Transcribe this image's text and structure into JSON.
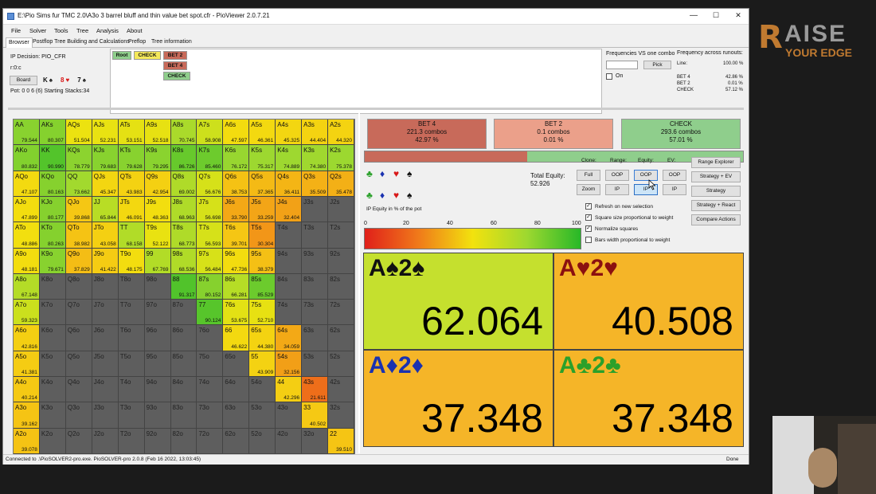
{
  "window": {
    "title": "E:\\Pio Sims fur TMC 2.0\\A3o 3 barrel bluff and thin value bet spot.cfr - PioViewer 2.0.7.21",
    "minimize": "—",
    "maximize": "☐",
    "close": "✕"
  },
  "menu": [
    "File",
    "Solver",
    "Tools",
    "Tree",
    "Analysis",
    "About"
  ],
  "tabs": [
    "Browser",
    "Postflop Tree Building and Calculations",
    "Preflop",
    "Tree information"
  ],
  "info": {
    "ip_decision": "IP Decision:  PIO_CFR",
    "line": "r:0:c",
    "board_button": "Board",
    "board_cards": [
      {
        "rank": "K",
        "suit": "♠",
        "color": "#111111"
      },
      {
        "rank": "8",
        "suit": "♥",
        "color": "#d81818"
      },
      {
        "rank": "7",
        "suit": "♠",
        "color": "#111111"
      }
    ],
    "pot": "Pot: 0 0 6 (6) Starting Stacks:34"
  },
  "tree": {
    "root": "Root",
    "check1": "CHECK",
    "bet2": "BET 2",
    "bet4": "BET 4",
    "check2": "CHECK"
  },
  "freq_panel": {
    "vs_one_combo": "Frequencies VS one combo",
    "pick": "Pick",
    "on": "On",
    "across_runouts": "Frequency across runouts:",
    "line_label": "Line:",
    "line_value": "100.00 %",
    "rows": [
      {
        "label": "BET 4",
        "value": "42.86 %"
      },
      {
        "label": "BET 2",
        "value": "0.01 %"
      },
      {
        "label": "CHECK",
        "value": "57.12 %"
      }
    ]
  },
  "actions": [
    {
      "name": "BET 4",
      "combos": "221.3 combos",
      "pct": "42.97 %",
      "color": "#c86a5a"
    },
    {
      "name": "BET 2",
      "combos": "0.1 combos",
      "pct": "0.01 %",
      "color": "#eba08a"
    },
    {
      "name": "CHECK",
      "combos": "293.6 combos",
      "pct": "57.01 %",
      "color": "#8fce8c"
    }
  ],
  "action_bar_fraction": 0.43,
  "controls": {
    "clone": "Clone:",
    "range": "Range:",
    "equity": "Equity:",
    "ev": "EV:",
    "full": "Full",
    "zoom": "Zoom",
    "oop1": "OOP",
    "ip1": "IP",
    "oop2": "OOP",
    "ip2": "IP",
    "oop3": "OOP",
    "ip3": "IP",
    "range_explorer": "Range Explorer",
    "strategy_ev": "Strategy + EV",
    "strategy": "Strategy",
    "strategy_react": "Strategy + React",
    "compare": "Compare Actions",
    "total_equity_label": "Total Equity:",
    "total_equity_value": "52.926",
    "refresh": "Refresh on new selection",
    "square": "Square size proportional to weight",
    "normalize": "Normalize squares",
    "bars": "Bars width proportional to weight",
    "ip_equity_label": "IP Equity in % of the pot",
    "scale": [
      "0",
      "20",
      "40",
      "60",
      "80",
      "100"
    ]
  },
  "combos": [
    {
      "name": "A♠2♠",
      "value": "62.064",
      "color": "#111111",
      "bg": "#c5e02e"
    },
    {
      "name": "A♥2♥",
      "value": "40.508",
      "color": "#8b1010",
      "bg": "#f5b528"
    },
    {
      "name": "A♦2♦",
      "value": "37.348",
      "color": "#1a32b0",
      "bg": "#f5b528"
    },
    {
      "name": "A♣2♣",
      "value": "37.348",
      "color": "#2aa02a",
      "bg": "#f5b528"
    }
  ],
  "status": {
    "left": "Connected to .\\PioSOLVER2-pro.exe. PioSOLVER-pro 2.0.8 (Feb 16 2022, 13:03:45)",
    "right": "Done"
  },
  "brand": {
    "line1": "AISE",
    "line2": "YOUR EDGE"
  },
  "grid": {
    "ranks": [
      "A",
      "K",
      "Q",
      "J",
      "T",
      "9",
      "8",
      "7",
      "6",
      "5",
      "4",
      "3",
      "2"
    ],
    "ev": {
      "AA": "79.544",
      "AKs": "80.307",
      "AQs": "51.504",
      "AJs": "52.231",
      "ATs": "53.151",
      "A9s": "52.518",
      "A8s": "70.745",
      "A7s": "58.908",
      "A6s": "47.597",
      "A5s": "46.361",
      "A4s": "45.325",
      "A3s": "44.404",
      "A2s": "44.320",
      "AKo": "80.832",
      "KK": "90.990",
      "KQs": "78.779",
      "KJs": "79.683",
      "KTs": "79.628",
      "K9s": "79.295",
      "K8s": "86.726",
      "K7s": "85.460",
      "K6s": "76.172",
      "K5s": "75.317",
      "K4s": "74.889",
      "K3s": "74.380",
      "K2s": "75.378",
      "AQo": "47.107",
      "KQo": "80.163",
      "QQ": "73.662",
      "QJs": "45.347",
      "QTs": "43.983",
      "Q9s": "42.954",
      "Q8s": "69.002",
      "Q7s": "56.676",
      "Q6s": "38.753",
      "Q5s": "37.365",
      "Q4s": "36.411",
      "Q3s": "35.509",
      "Q2s": "35.478",
      "AJo": "47.899",
      "KJo": "80.177",
      "QJo": "39.868",
      "JJ": "65.844",
      "JTs": "46.091",
      "J9s": "48.363",
      "J8s": "68.963",
      "J7s": "56.698",
      "J6s": "33.790",
      "J5s": "33.259",
      "J4s": "32.404",
      "ATo": "48.886",
      "KTo": "80.263",
      "QTo": "38.982",
      "JTo": "43.058",
      "TT": "68.158",
      "T9s": "52.122",
      "T8s": "68.773",
      "T7s": "56.593",
      "T6s": "39.701",
      "T5s": "30.304",
      "A9o": "48.181",
      "K9o": "79.671",
      "Q9o": "37.829",
      "J9o": "41.422",
      "T9o": "48.175",
      "99": "67.769",
      "98s": "68.536",
      "97s": "56.484",
      "96s": "47.736",
      "95s": "38.379",
      "A8o": "67.148",
      "88": "91.317",
      "87s": "80.152",
      "86s": "66.281",
      "85s": "85.529",
      "A7o": "59.323",
      "77": "90.124",
      "76s": "53.675",
      "75s": "52.710",
      "A6o": "42.816",
      "66": "46.622",
      "65s": "44.380",
      "64s": "34.059",
      "A5o": "41.381",
      "55": "43.909",
      "54s": "32.156",
      "A4o": "40.214",
      "44": "42.296",
      "43s": "21.611",
      "A3o": "39.162",
      "33": "40.502",
      "A2o": "39.078",
      "22": "39.510"
    }
  }
}
